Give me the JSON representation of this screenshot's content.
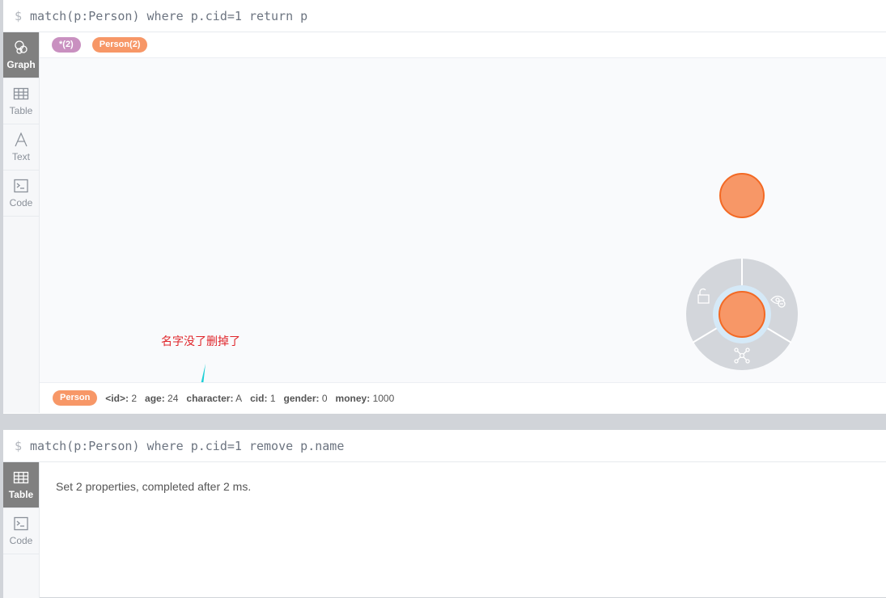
{
  "frames": [
    {
      "command": "match(p:Person) where p.cid=1 return p",
      "prompt": "$",
      "sidebar": [
        "Graph",
        "Table",
        "Text",
        "Code"
      ],
      "active_tab": "Graph",
      "legend": {
        "all": "*(2)",
        "person": "Person(2)"
      },
      "annotation": "名字没了删掉了",
      "properties": {
        "label": "Person",
        "items": [
          {
            "key": "<id>:",
            "value": "2"
          },
          {
            "key": "age:",
            "value": "24"
          },
          {
            "key": "character:",
            "value": "A"
          },
          {
            "key": "cid:",
            "value": "1"
          },
          {
            "key": "gender:",
            "value": "0"
          },
          {
            "key": "money:",
            "value": "1000"
          }
        ]
      }
    },
    {
      "command": "match(p:Person) where p.cid=1 remove p.name",
      "prompt": "$",
      "sidebar": [
        "Table",
        "Code"
      ],
      "active_tab": "Table",
      "result": "Set 2 properties, completed after 2 ms."
    }
  ],
  "colors": {
    "person": "#f79767",
    "all": "#c990c0",
    "annotation": "#e0262b",
    "arrow": "#1ecfd6"
  }
}
